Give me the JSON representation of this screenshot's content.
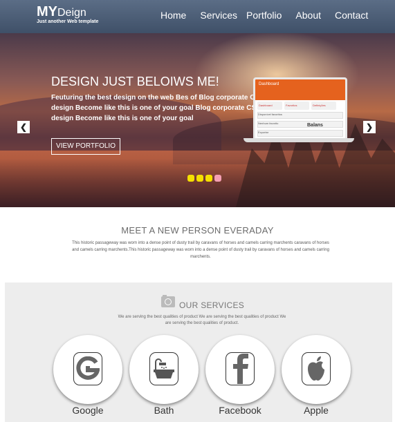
{
  "header": {
    "brand_bold": "MY",
    "brand_rest": "Deign",
    "tagline": "Just another Web template",
    "nav": [
      "Home",
      "Services",
      "Portfolio",
      "About",
      "Contact"
    ]
  },
  "hero": {
    "title": "DESIGN JUST BELOIWS ME!",
    "text": "Feuturing the best design on the web Bes of Blog corporate CSS design Become like this is one of your goal Blog corporate CSS design Become like this is one of your goal",
    "button": "VIEW PORTFOLIO",
    "arrow_left": "❮",
    "arrow_right": "❯",
    "slides": 4,
    "active_slide": 4,
    "laptop_screen": {
      "title": "Dashboard",
      "tabs": [
        "Dashboard",
        "Favoritos",
        "Definições"
      ],
      "rows": [
        "Disponível favoritos",
        "Nenhum favorito",
        "Exportar"
      ],
      "label": "Balans"
    }
  },
  "meet": {
    "title": "MEET A NEW PERSON EVERADAY",
    "text": "This historic passageway was worn into a dense point of dusty trail by caravans of horses and camels carring marchents caravans of horses and camels carring marchents.This historic passageway was worn into a dense point of dusty trail by caravans of horses and camels carring marchents."
  },
  "services": {
    "title": "OUR SERVICES",
    "text": "We are serving the best qualities of product We are serving the best qualities of product We are serving the best qualities of product.",
    "items": [
      {
        "label": "Google",
        "icon": "google-icon"
      },
      {
        "label": "Bath",
        "icon": "bath-icon"
      },
      {
        "label": "Facebook",
        "icon": "facebook-icon"
      },
      {
        "label": "Apple",
        "icon": "apple-icon"
      }
    ]
  },
  "colors": {
    "header_bg": "#4b5c75",
    "dot": "#f5e000",
    "dot_active": "#f5a0b4",
    "laptop_accent": "#e5621e"
  }
}
